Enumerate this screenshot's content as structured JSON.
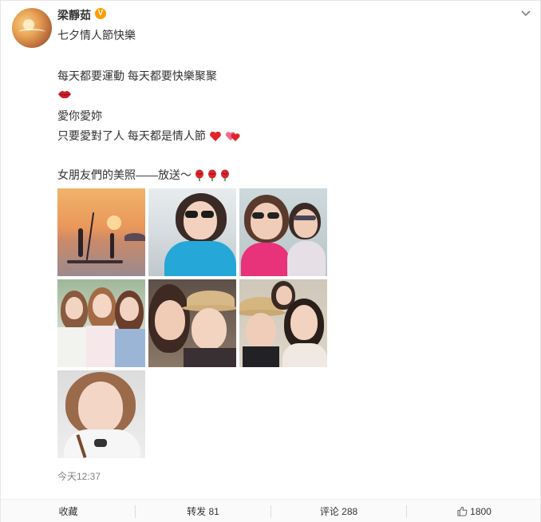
{
  "post": {
    "username": "梁靜茹",
    "verified_badge": "V",
    "subtitle": "七夕情人節快樂",
    "lines": [
      "每天都要運動 每天都要快樂聚聚",
      "愛你愛妳",
      "只要愛對了人 每天都是情人節",
      "女朋友們的美照——放送～"
    ],
    "emojis": [
      "lips-emoji",
      "heart-emoji",
      "two-hearts-emoji",
      "rose-emoji",
      "rose-emoji",
      "rose-emoji"
    ],
    "photos": [
      "sunset-paddleboard-photo",
      "selfie-sunglasses-photo",
      "selfie-two-friends-sunglasses-photo",
      "three-friends-photo",
      "two-friends-straw-hat-photo",
      "three-friends-straw-hat-photo",
      "selfie-portrait-photo"
    ],
    "timestamp": "今天12:37"
  },
  "actions": {
    "favorite_label": "收藏",
    "repost_label": "转发 81",
    "comment_label": "评论 288",
    "like_count": "1800"
  },
  "colors": {
    "accent_badge": "#ff9c00",
    "text": "#333333",
    "muted": "#808080",
    "heart": "#e0242b"
  }
}
